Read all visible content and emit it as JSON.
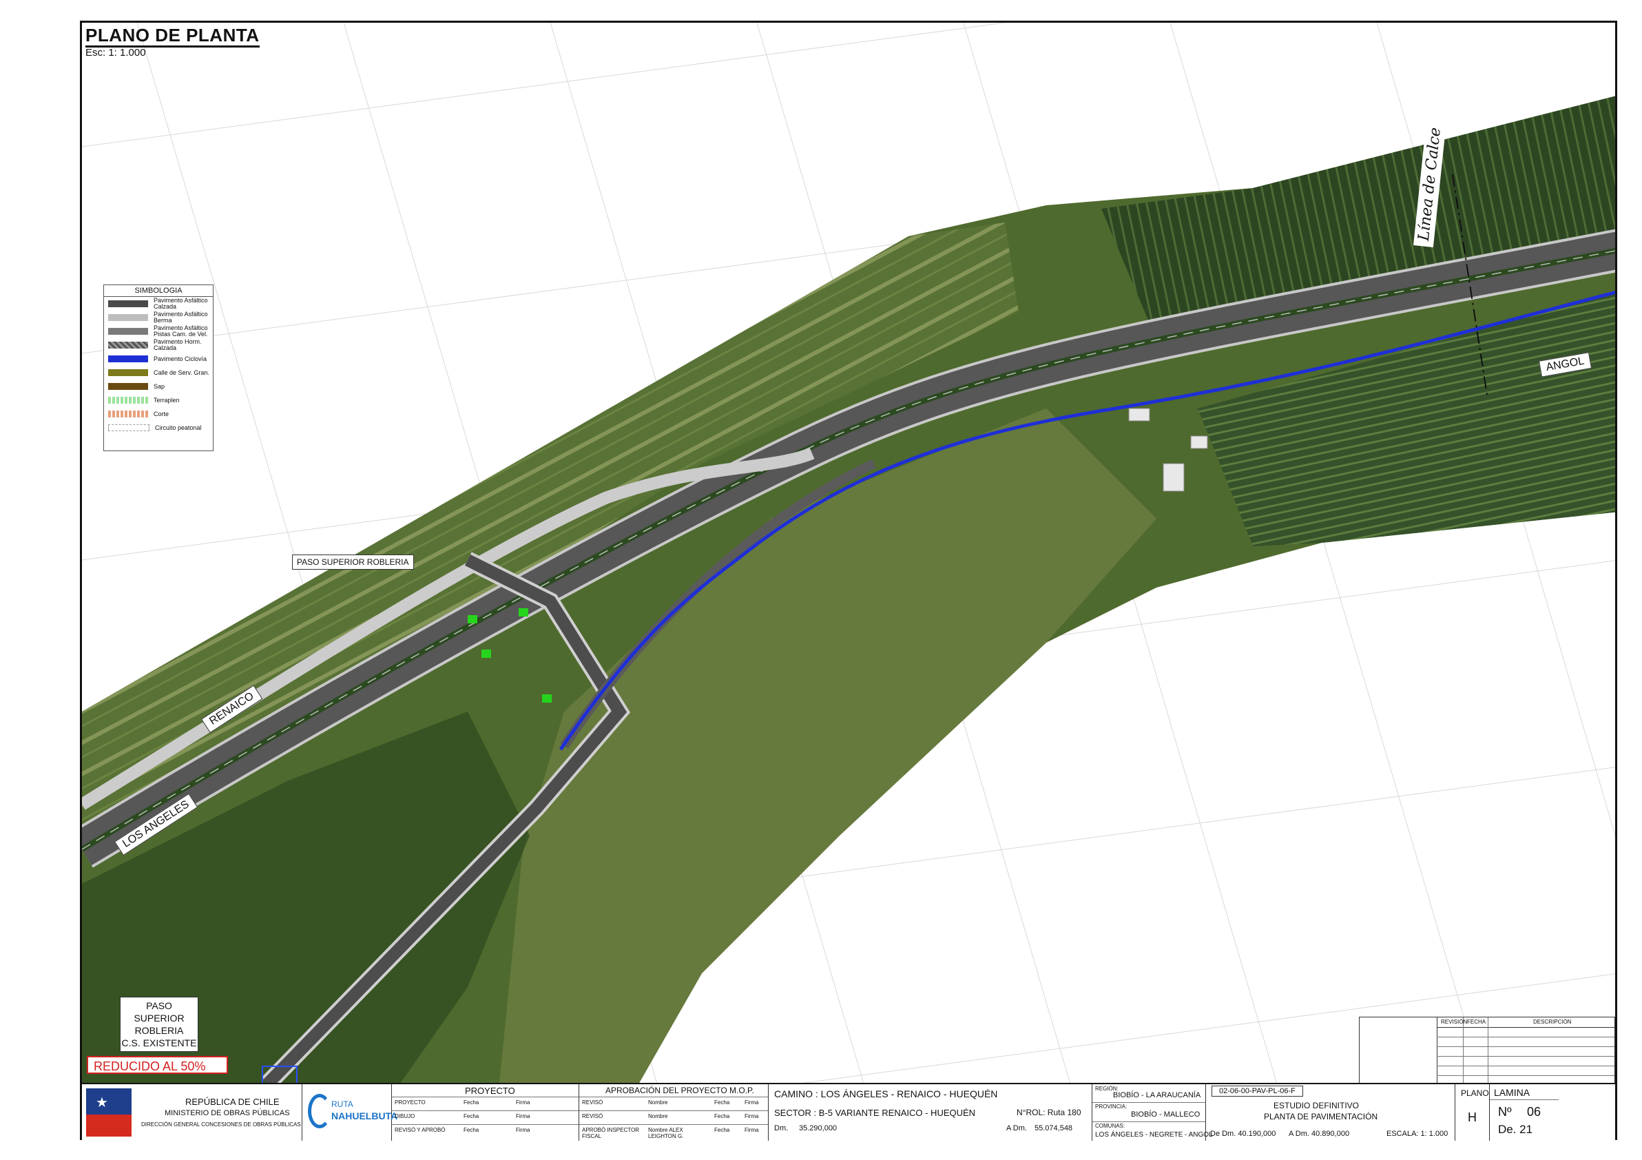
{
  "title": "PLANO DE PLANTA",
  "scale_label": "Esc: 1: 1.000",
  "legend": {
    "heading": "SIMBOLOGIA",
    "items": [
      {
        "label": "Pavimento Asfáltico Calzada",
        "color": "#4a4a4a"
      },
      {
        "label": "Pavimento Asfáltico Berma",
        "color": "#bdbdbd"
      },
      {
        "label": "Pavimento Asfáltico Pistas Cam. de Vel.",
        "color": "#7a7a7a"
      },
      {
        "label": "Pavimento Horm. Calzada",
        "color": "#666666"
      },
      {
        "label": "Pavimento Ciclovía",
        "color": "#1f2fd6"
      },
      {
        "label": "Calle de Serv. Gran.",
        "color": "#7d7a1a"
      },
      {
        "label": "Sap",
        "color": "#6b4a12"
      },
      {
        "label": "Terraplen",
        "color": "#9be29b"
      },
      {
        "label": "Corte",
        "color": "#e8a07c"
      },
      {
        "label": "Circuito peatonal",
        "color": "#cfcfcf"
      }
    ]
  },
  "map_labels": {
    "renaico": "RENAICO",
    "los_angeles": "LOS ANGELES",
    "angol": "ANGOL",
    "paso_superior": "PASO SUPERIOR ROBLERIA",
    "linea_calce": "Línea de Calce",
    "existente": [
      "PASO SUPERIOR",
      "ROBLERIA",
      "C.S. EXISTENTE"
    ]
  },
  "reducido": "REDUCIDO AL 50%",
  "colors": {
    "field": "#4f6a2e",
    "orchard": "#2f4a24",
    "road": "#555555",
    "shoulder": "#c8c8c8",
    "bikepath": "#1f2fd6"
  },
  "revision_table": {
    "col1": "REVISIÓN",
    "col2": "FECHA",
    "col3": "DESCRIPCIÓN"
  },
  "title_block": {
    "gov": [
      "REPÚBLICA DE CHILE",
      "MINISTERIO DE OBRAS PÚBLICAS",
      "DIRECCIÓN GENERAL CONCESIONES DE OBRAS PÚBLICAS"
    ],
    "logo_text": "RUTA",
    "logo_name": "NAHUELBUTA",
    "proyecto_header": "PROYECTO",
    "proyecto_rows": [
      "PROYECTO",
      "DIBUJO",
      "REVISÓ Y APROBÓ"
    ],
    "fecha": "Fecha",
    "firma": "Firma",
    "aprobacion_header": "APROBACIÓN DEL PROYECTO M.O.P.",
    "aprobacion_rows": [
      "REVISÓ",
      "REVISÓ",
      "APROBÓ INSPECTOR FISCAL"
    ],
    "nombre": "Nombre",
    "nombre_final": "Nombre ALEX LEIGHTON G.",
    "camino": "CAMINO : LOS ÁNGELES - RENAICO - HUEQUÉN",
    "sector": "SECTOR : B-5 VARIANTE RENAICO - HUEQUÉN",
    "rol": "N°ROL: Ruta 180",
    "dm_label": "Dm.",
    "dm_value": "35.290,000",
    "adm_label": "A Dm.",
    "adm_value": "55.074,548",
    "region_label": "REGIÓN:",
    "region_value": "BIOBÍO - LA ARAUCANÍA",
    "provincia_label": "PROVINCIA:",
    "provincia_value": "BIOBÍO - MALLECO",
    "comunas_label": "COMUNAS:",
    "comunas_value": "LOS ÁNGELES - NEGRETE - ANGOL",
    "code": "02-06-00-PAV-PL-06-F",
    "estudio": "ESTUDIO DEFINITIVO",
    "planta": "PLANTA DE PAVIMENTACIÓN",
    "de_dm": "De Dm. 40.190,000",
    "a_dm": "A Dm. 40.890,000",
    "escala": "ESCALA:  1: 1.000",
    "plano_label": "PLANO",
    "plano_value": "H",
    "lamina_label": "LAMINA",
    "lamina_no": "Nº",
    "lamina_value": "06",
    "lamina_total": "De. 21"
  }
}
